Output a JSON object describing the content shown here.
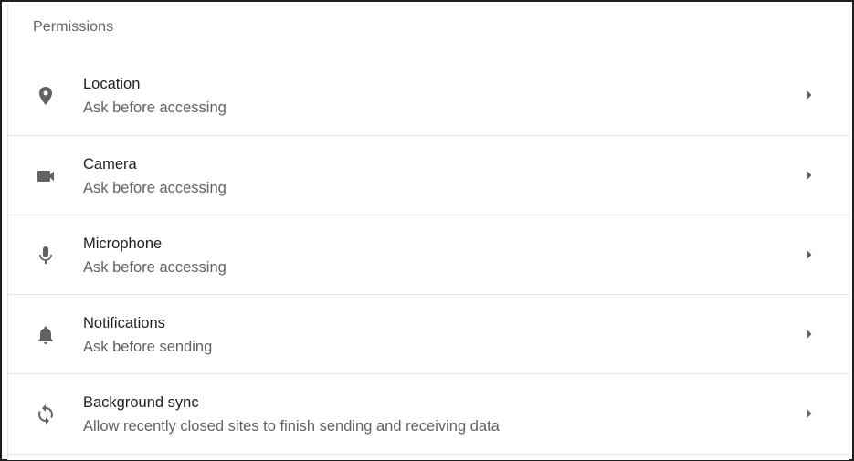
{
  "section": {
    "title": "Permissions"
  },
  "items": [
    {
      "icon": "location-pin-icon",
      "title": "Location",
      "subtitle": "Ask before accessing"
    },
    {
      "icon": "camera-icon",
      "title": "Camera",
      "subtitle": "Ask before accessing"
    },
    {
      "icon": "microphone-icon",
      "title": "Microphone",
      "subtitle": "Ask before accessing"
    },
    {
      "icon": "bell-icon",
      "title": "Notifications",
      "subtitle": "Ask before sending"
    },
    {
      "icon": "sync-icon",
      "title": "Background sync",
      "subtitle": "Allow recently closed sites to finish sending and receiving data"
    }
  ],
  "colors": {
    "icon": "#5f6368",
    "title": "#202124",
    "subtitle": "#5f6368",
    "divider": "#e3e3e3"
  }
}
